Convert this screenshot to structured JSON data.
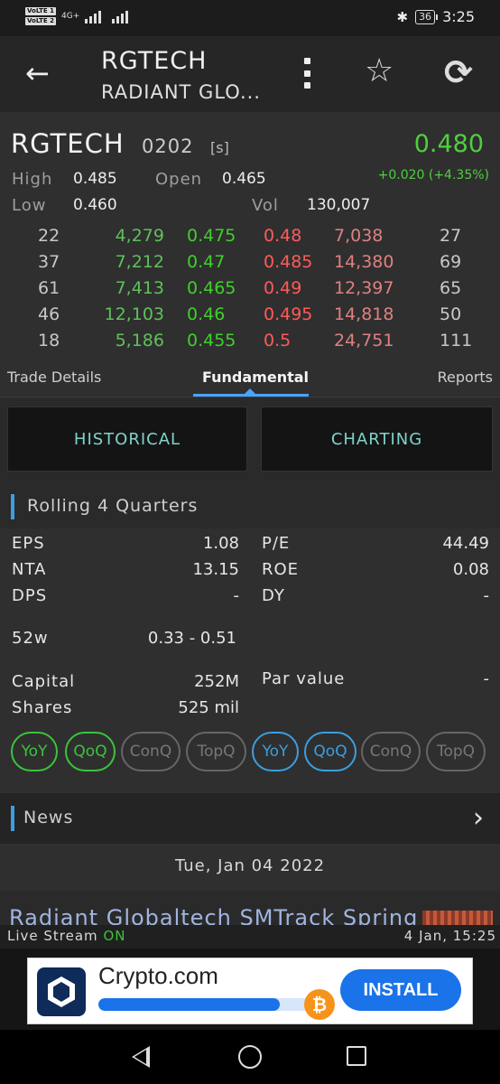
{
  "status_bar": {
    "volte1": "VoLTE 1",
    "volte2": "VoLTE 2",
    "network": "4G+",
    "battery": "36",
    "time": "3:25"
  },
  "app_bar": {
    "title": "RGTECH",
    "subtitle": "RADIANT GLO...",
    "icons": [
      "back-arrow-icon",
      "more-vert-icon",
      "star-icon",
      "refresh-icon"
    ]
  },
  "quote": {
    "code": "RGTECH",
    "number": "0202",
    "board": "[s]",
    "price": "0.480",
    "change": "+0.020 (+4.35%)",
    "high_label": "High",
    "high": "0.485",
    "open_label": "Open",
    "open": "0.465",
    "low_label": "Low",
    "low": "0.460",
    "vol_label": "Vol",
    "vol": "130,007"
  },
  "order_book": [
    {
      "bid_count": "22",
      "bid_qty": "4,279",
      "bid": "0.475",
      "ask": "0.48",
      "ask_qty": "7,038",
      "ask_count": "27"
    },
    {
      "bid_count": "37",
      "bid_qty": "7,212",
      "bid": "0.47",
      "ask": "0.485",
      "ask_qty": "14,380",
      "ask_count": "69"
    },
    {
      "bid_count": "61",
      "bid_qty": "7,413",
      "bid": "0.465",
      "ask": "0.49",
      "ask_qty": "12,397",
      "ask_count": "65"
    },
    {
      "bid_count": "46",
      "bid_qty": "12,103",
      "bid": "0.46",
      "ask": "0.495",
      "ask_qty": "14,818",
      "ask_count": "50"
    },
    {
      "bid_count": "18",
      "bid_qty": "5,186",
      "bid": "0.455",
      "ask": "0.5",
      "ask_qty": "24,751",
      "ask_count": "111"
    }
  ],
  "tabs": {
    "trade": "Trade Details",
    "fundamental": "Fundamental",
    "reports": "Reports",
    "active": "fundamental"
  },
  "buttons": {
    "historical": "HISTORICAL",
    "charting": "CHARTING"
  },
  "rolling": {
    "title": "Rolling 4 Quarters",
    "eps_label": "EPS",
    "eps": "1.08",
    "pe_label": "P/E",
    "pe": "44.49",
    "nta_label": "NTA",
    "nta": "13.15",
    "roe_label": "ROE",
    "roe": "0.08",
    "dps_label": "DPS",
    "dps": "-",
    "dy_label": "DY",
    "dy": "-",
    "w52_label": "52w",
    "w52": "0.33 - 0.51",
    "capital_label": "Capital",
    "capital": "252M",
    "par_label": "Par value",
    "par": "-",
    "shares_label": "Shares",
    "shares": "525 mil"
  },
  "pills": {
    "left": [
      {
        "label": "YoY",
        "state": "active"
      },
      {
        "label": "QoQ",
        "state": "active"
      },
      {
        "label": "ConQ",
        "state": "inactive"
      },
      {
        "label": "TopQ",
        "state": "inactive"
      }
    ],
    "right": [
      {
        "label": "YoY",
        "state": "active"
      },
      {
        "label": "QoQ",
        "state": "active"
      },
      {
        "label": "ConQ",
        "state": "inactive"
      },
      {
        "label": "TopQ",
        "state": "inactive"
      }
    ]
  },
  "news": {
    "title": "News",
    "date": "Tue, Jan 04 2022",
    "headline": "Radiant Globaltech SMTrack Spring"
  },
  "live": {
    "label": "Live Stream",
    "state": "ON",
    "timestamp": "4 Jan, 15:25"
  },
  "ad": {
    "name": "Crypto.com",
    "install": "INSTALL",
    "progress": 0.78
  },
  "colors": {
    "up": "#3bc43b",
    "down": "#ff5a5a",
    "accent": "#3c9ee0",
    "teal": "#7fd3cc"
  }
}
